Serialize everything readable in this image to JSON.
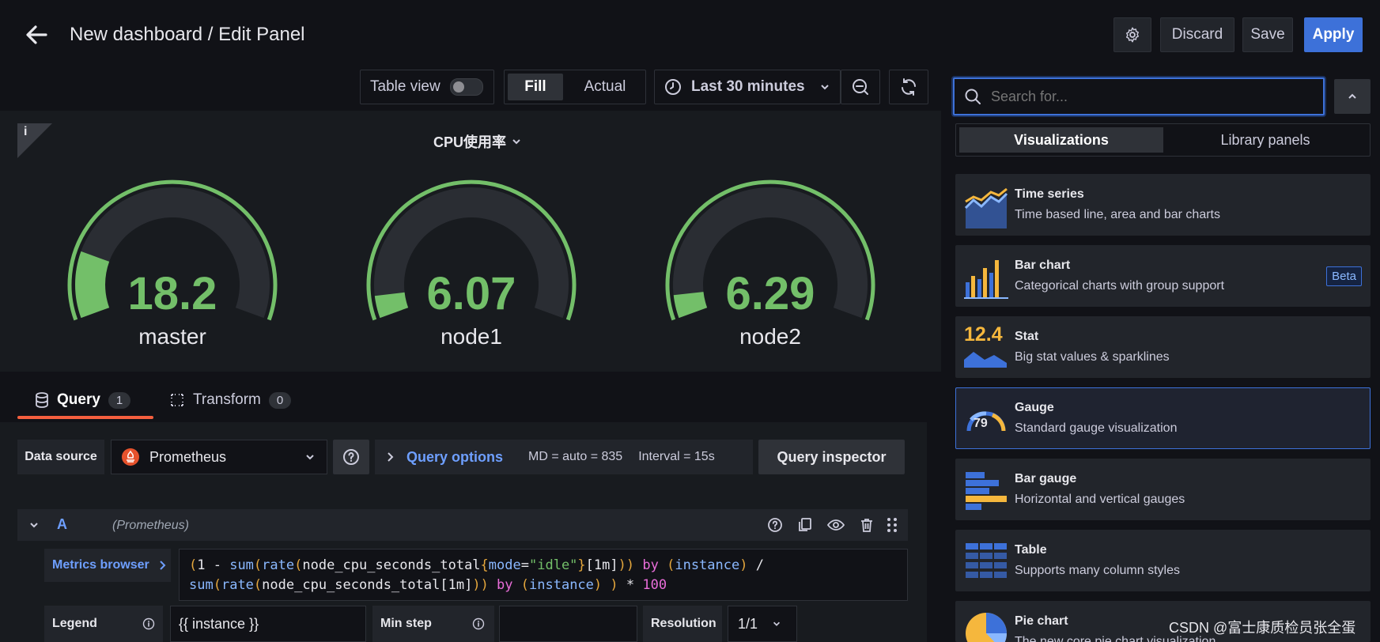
{
  "header": {
    "title": "New dashboard / Edit Panel",
    "discard_label": "Discard",
    "save_label": "Save",
    "apply_label": "Apply"
  },
  "toolbar": {
    "table_view_label": "Table view",
    "fill_label": "Fill",
    "actual_label": "Actual",
    "time_range": "Last 30 minutes"
  },
  "panel": {
    "title": "CPU使用率",
    "info_icon": "i",
    "gauges": [
      {
        "value": "18.2",
        "label": "master",
        "fraction": 0.182
      },
      {
        "value": "6.07",
        "label": "node1",
        "fraction": 0.0607
      },
      {
        "value": "6.29",
        "label": "node2",
        "fraction": 0.0629
      }
    ]
  },
  "tabs": {
    "query_label": "Query",
    "query_count": "1",
    "transform_label": "Transform",
    "transform_count": "0"
  },
  "query": {
    "datasource_label": "Data source",
    "datasource_value": "Prometheus",
    "options_label": "Query options",
    "md_text": "MD = auto = 835",
    "interval_text": "Interval = 15s",
    "inspector_label": "Query inspector",
    "row_letter": "A",
    "row_source": "(Prometheus)",
    "metrics_browser_label": "Metrics browser",
    "legend_label": "Legend",
    "legend_value": "{{ instance }}",
    "min_step_label": "Min step",
    "resolution_label": "Resolution",
    "resolution_value": "1/1"
  },
  "expr": {
    "p1": "(",
    "p2": "1 - ",
    "p3": "sum",
    "p4": "(",
    "p5": "rate",
    "p6": "(",
    "p7": "node_cpu_seconds_total",
    "p8": "{",
    "p9": "mode",
    "p10": "=",
    "p11": "\"idle\"",
    "p12": "}",
    "p13": "[",
    "p14": "1m",
    "p15": "]",
    "p16": "))",
    "p17": " by ",
    "p18": "(",
    "p19": "instance",
    "p20": ")",
    "p21": " /",
    "q1": "sum",
    "q2": "(",
    "q3": "rate",
    "q4": "(",
    "q5": "node_cpu_seconds_total",
    "q6": "[",
    "q7": "1m",
    "q8": "]",
    "q9": "))",
    "q10": " by ",
    "q11": "(",
    "q12": "instance",
    "q13": ") ",
    "q14": ")",
    "q15": " * ",
    "q16": "100"
  },
  "visualizations": {
    "search_placeholder": "Search for...",
    "tab_visualizations": "Visualizations",
    "tab_library": "Library panels",
    "items": [
      {
        "name": "Time series",
        "desc": "Time based line, area and bar charts"
      },
      {
        "name": "Bar chart",
        "desc": "Categorical charts with group support",
        "badge": "Beta"
      },
      {
        "name": "Stat",
        "desc": "Big stat values & sparklines",
        "icon_text": "12.4"
      },
      {
        "name": "Gauge",
        "desc": "Standard gauge visualization",
        "icon_text": "79"
      },
      {
        "name": "Bar gauge",
        "desc": "Horizontal and vertical gauges"
      },
      {
        "name": "Table",
        "desc": "Supports many column styles"
      },
      {
        "name": "Pie chart",
        "desc": "The new core pie chart visualization"
      }
    ]
  },
  "watermark": "CSDN @富士康质检员张全蛋",
  "colors": {
    "accent": "#3d71d9",
    "gauge_green": "#73bf69",
    "tab_underline": "#f55f3e"
  }
}
